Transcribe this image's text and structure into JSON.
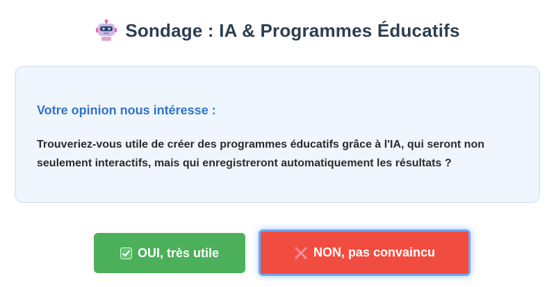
{
  "header": {
    "icon": "robot-icon",
    "title": "Sondage : IA & Programmes Éducatifs"
  },
  "card": {
    "heading": "Votre opinion nous intéresse :",
    "question": "Trouveriez-vous utile de créer des programmes éducatifs grâce à l'IA, qui seront non seulement interactifs, mais qui enregistreront automatiquement les résultats ?"
  },
  "buttons": {
    "yes": {
      "icon": "check-mark-icon",
      "label": "OUI, très utile",
      "color": "#4caf5a"
    },
    "no": {
      "icon": "cross-mark-icon",
      "label": "NON, pas convaincu",
      "color": "#f04d40"
    }
  }
}
